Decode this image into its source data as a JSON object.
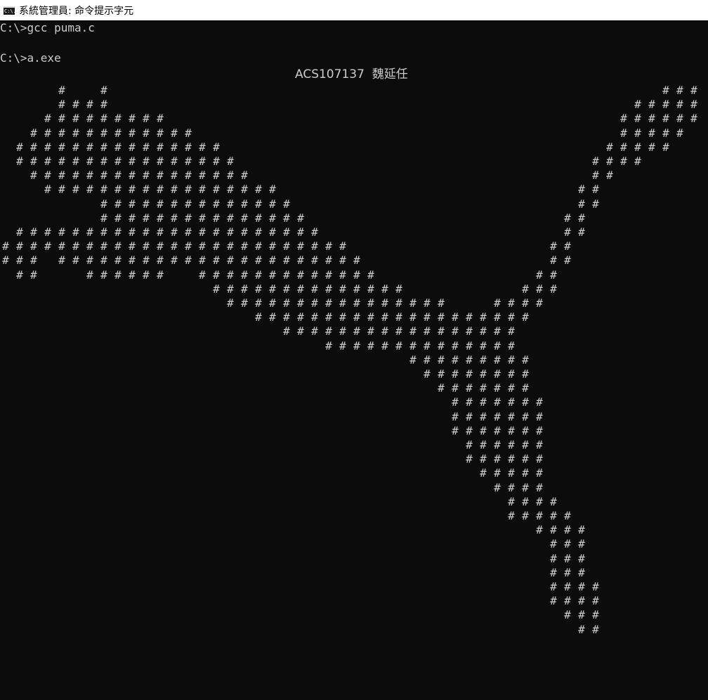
{
  "window": {
    "title": "系統管理員: 命令提示字元",
    "icon": "cmd-icon",
    "icon_text": "C:\\."
  },
  "console": {
    "lines": [
      "C:\\>gcc puma.c",
      "",
      "C:\\>a.exe"
    ],
    "header": "ACS107137  魏延任",
    "glyph": "#",
    "art_rows": [
      [
        4,
        7
      ],
      [
        4,
        5,
        6,
        7
      ],
      [
        3,
        4,
        5,
        6,
        7,
        8,
        9,
        10,
        11
      ],
      [
        2,
        3,
        4,
        5,
        6,
        7,
        8,
        9,
        10,
        11,
        12,
        13
      ],
      [
        1,
        2,
        3,
        4,
        5,
        6,
        7,
        8,
        9,
        10,
        11,
        12,
        13,
        14,
        15
      ],
      [
        1,
        2,
        3,
        4,
        5,
        6,
        7,
        8,
        9,
        10,
        11,
        12,
        13,
        14,
        15,
        16
      ],
      [
        2,
        3,
        4,
        5,
        6,
        7,
        8,
        9,
        10,
        11,
        12,
        13,
        14,
        15,
        16,
        17
      ],
      [
        3,
        4,
        5,
        6,
        7,
        8,
        9,
        10,
        11,
        12,
        13,
        14,
        15,
        16,
        17,
        18,
        19
      ],
      [
        7,
        8,
        9,
        10,
        11,
        12,
        13,
        14,
        15,
        16,
        17,
        18,
        19,
        20
      ],
      [
        7,
        8,
        9,
        10,
        11,
        12,
        13,
        14,
        15,
        16,
        17,
        18,
        19,
        20,
        21
      ],
      [
        1,
        2,
        3,
        4,
        5,
        6,
        7,
        8,
        9,
        10,
        11,
        12,
        13,
        14,
        15,
        16,
        17,
        18,
        19,
        20,
        21,
        22
      ],
      [
        0,
        1,
        2,
        3,
        4,
        5,
        6,
        7,
        8,
        9,
        10,
        11,
        12,
        13,
        14,
        15,
        16,
        17,
        18,
        19,
        20,
        21,
        22,
        23,
        24
      ],
      [
        0,
        1,
        2,
        4,
        5,
        6,
        7,
        8,
        9,
        10,
        11,
        12,
        13,
        14,
        15,
        16,
        17,
        18,
        19,
        20,
        21,
        22,
        23,
        24,
        25
      ],
      [
        1,
        2,
        6,
        7,
        8,
        9,
        10,
        11,
        14,
        15,
        16,
        17,
        18,
        19,
        20,
        21,
        22,
        23,
        24,
        25,
        26
      ],
      [
        15,
        16,
        17,
        18,
        19,
        20,
        21,
        22,
        23,
        24,
        25,
        26,
        27,
        28
      ],
      [
        16,
        17,
        18,
        19,
        20,
        21,
        22,
        23,
        24,
        25,
        26,
        27,
        28,
        29,
        30,
        31
      ],
      [
        18,
        19,
        20,
        21,
        22,
        23,
        24,
        25,
        26,
        27,
        28,
        29,
        30,
        31,
        32,
        33,
        34,
        35,
        36,
        37
      ],
      [
        20,
        21,
        22,
        23,
        24,
        25,
        26,
        27,
        28,
        29,
        30,
        31,
        32,
        33,
        34,
        35,
        36
      ],
      [
        23,
        24,
        25,
        26,
        27,
        28,
        29,
        30,
        31,
        32,
        33,
        34,
        35,
        36
      ],
      [
        29,
        30,
        31,
        32,
        33,
        34,
        35,
        36,
        37
      ],
      [
        30,
        31,
        32,
        33,
        34,
        35,
        36,
        37
      ],
      [
        31,
        32,
        33,
        34,
        35,
        36,
        37
      ],
      [
        32,
        33,
        34,
        35,
        36,
        37,
        38
      ],
      [
        32,
        33,
        34,
        35,
        36,
        37,
        38
      ],
      [
        32,
        33,
        34,
        35,
        36,
        37,
        38
      ],
      [
        33,
        34,
        35,
        36,
        37,
        38
      ],
      [
        33,
        34,
        35,
        36,
        37,
        38
      ],
      [
        34,
        35,
        36,
        37,
        38
      ],
      [
        35,
        36,
        37,
        38
      ],
      [
        36,
        37,
        38,
        39
      ],
      [
        36,
        37,
        38,
        39,
        40
      ],
      [
        38,
        39,
        40,
        41
      ],
      [
        39,
        40,
        41
      ],
      [
        39,
        40,
        41
      ],
      [
        39,
        40,
        41
      ],
      [
        39,
        40,
        41,
        42
      ],
      [
        39,
        40,
        41,
        42
      ],
      [
        40,
        41,
        42
      ],
      [
        41,
        42
      ]
    ],
    "art_rows_right": [
      [
        47,
        48,
        49
      ],
      [
        45,
        46,
        47,
        48,
        49
      ],
      [
        44,
        45,
        46,
        47,
        48,
        49
      ],
      [
        44,
        45,
        46,
        47,
        48
      ],
      [
        43,
        44,
        45,
        46,
        47
      ],
      [
        42,
        43,
        44,
        45
      ],
      [
        42,
        43
      ],
      [
        41,
        42
      ],
      [
        41,
        42
      ],
      [
        40,
        41
      ],
      [
        40,
        41
      ],
      [
        39,
        40
      ],
      [
        39,
        40
      ],
      [
        38,
        39
      ],
      [
        37,
        38,
        39
      ],
      [
        35,
        36,
        37,
        38
      ],
      [
        31,
        32,
        33,
        34,
        35,
        36,
        37
      ]
    ]
  }
}
